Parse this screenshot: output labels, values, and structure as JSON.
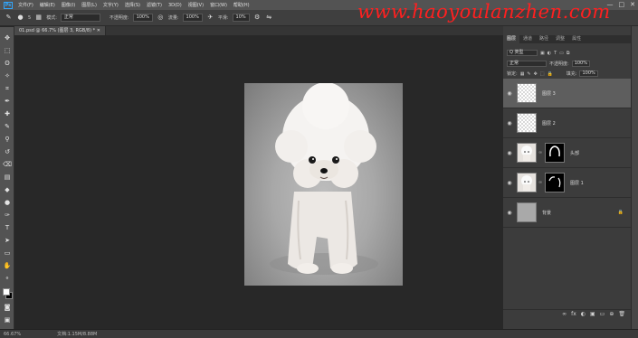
{
  "menu": {
    "logo": "Ps",
    "items": [
      "文件(F)",
      "编辑(E)",
      "图像(I)",
      "图层(L)",
      "文字(Y)",
      "选择(S)",
      "滤镜(T)",
      "3D(D)",
      "视图(V)",
      "窗口(W)",
      "帮助(H)"
    ],
    "minimize": "—",
    "maximize": "□",
    "close": "✕"
  },
  "watermark": "www.haoyoulanzhen.com",
  "options": {
    "brush_size": "5",
    "mode_label": "模式:",
    "mode_value": "正常",
    "opacity_label": "不透明度:",
    "opacity_value": "100%",
    "flow_label": "流量:",
    "flow_value": "100%",
    "smooth_label": "平滑:",
    "smooth_value": "10%"
  },
  "document": {
    "tab_title": "01.psd @ 66.7% (图层 3, RGB/8) * ✕"
  },
  "status": {
    "zoom": "66.67%",
    "doc_size": "文档:1.15M/8.88M"
  },
  "panels": {
    "tabs": [
      "图层",
      "通道",
      "路径",
      "调整",
      "属性"
    ],
    "filter_label": "Q 类型",
    "blend_mode": "正常",
    "opacity_label": "不透明度:",
    "opacity_value": "100%",
    "lock_label": "锁定:",
    "fill_label": "填充:",
    "fill_value": "100%",
    "footer_icons": [
      "∞",
      "fx",
      "◐",
      "▣",
      "▭",
      "⊕",
      "🗑"
    ]
  },
  "layers": [
    {
      "name": "图层 3",
      "type": "transparent",
      "selected": true,
      "mask": false
    },
    {
      "name": "图层 2",
      "type": "transparent",
      "selected": false,
      "mask": false
    },
    {
      "name": "头部",
      "type": "dog",
      "selected": false,
      "mask": true
    },
    {
      "name": "图层 1",
      "type": "dog",
      "selected": false,
      "mask": true
    },
    {
      "name": "背景",
      "type": "bg",
      "selected": false,
      "mask": false,
      "locked": true
    }
  ]
}
